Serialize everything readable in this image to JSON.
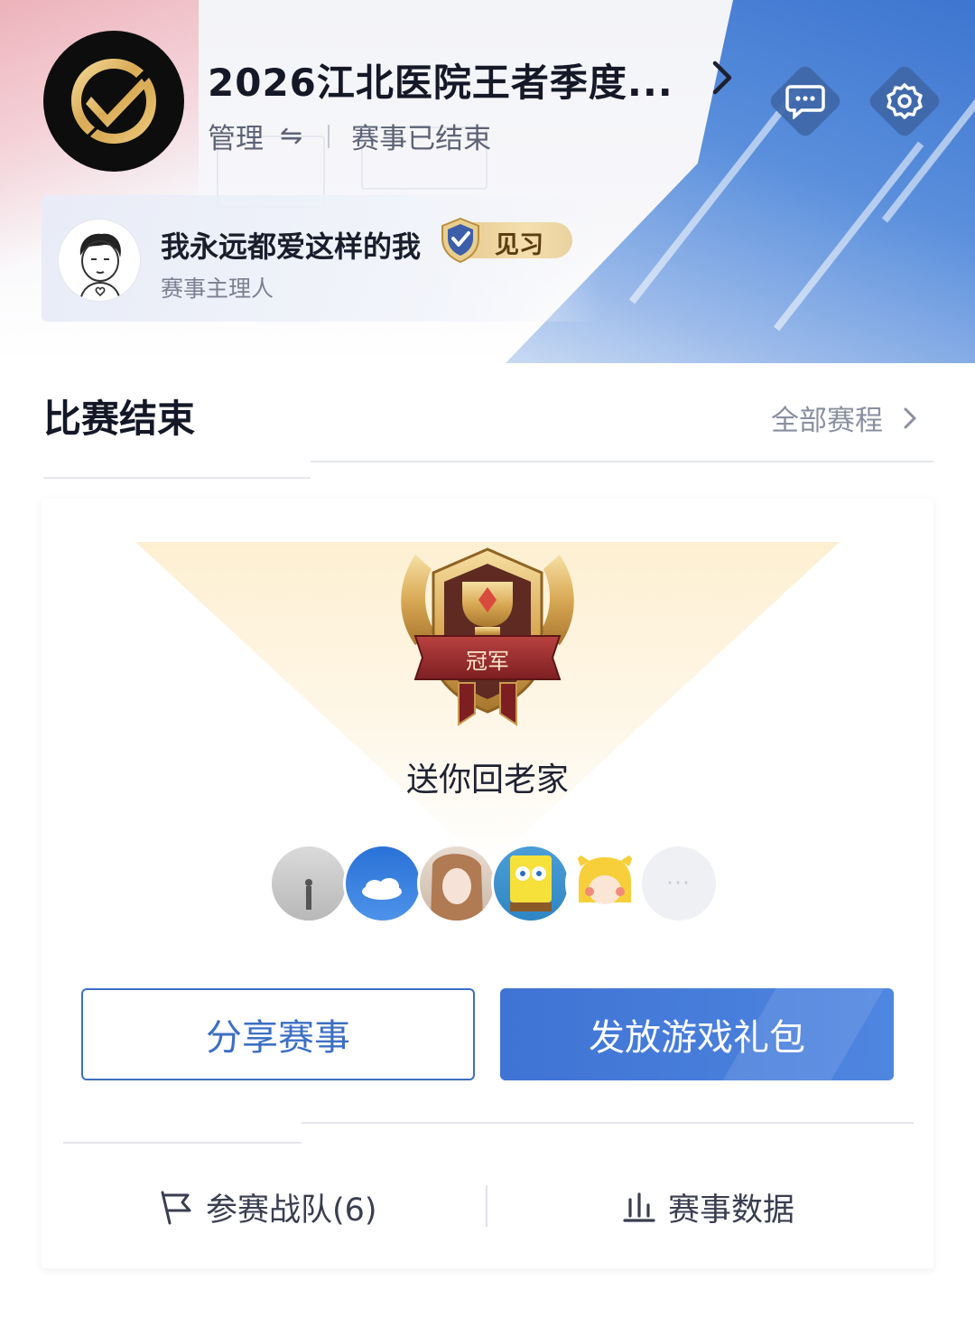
{
  "header": {
    "title": "2026江北医院王者季度...",
    "manage_label": "管理",
    "swap_symbol": "⇋",
    "status": "赛事已结束"
  },
  "host": {
    "name": "我永远都爱这样的我",
    "badge": "见习",
    "role": "赛事主理人"
  },
  "section": {
    "title": "比赛结束",
    "link": "全部赛程"
  },
  "result": {
    "trophy_label": "冠军",
    "team_name": "送你回老家",
    "more_symbol": "···"
  },
  "actions": {
    "share": "分享赛事",
    "gift": "发放游戏礼包"
  },
  "tabs": {
    "teams": "参赛战队(6)",
    "data": "赛事数据"
  },
  "colors": {
    "accent": "#3c6fc3",
    "gold": "#e6c98d"
  }
}
